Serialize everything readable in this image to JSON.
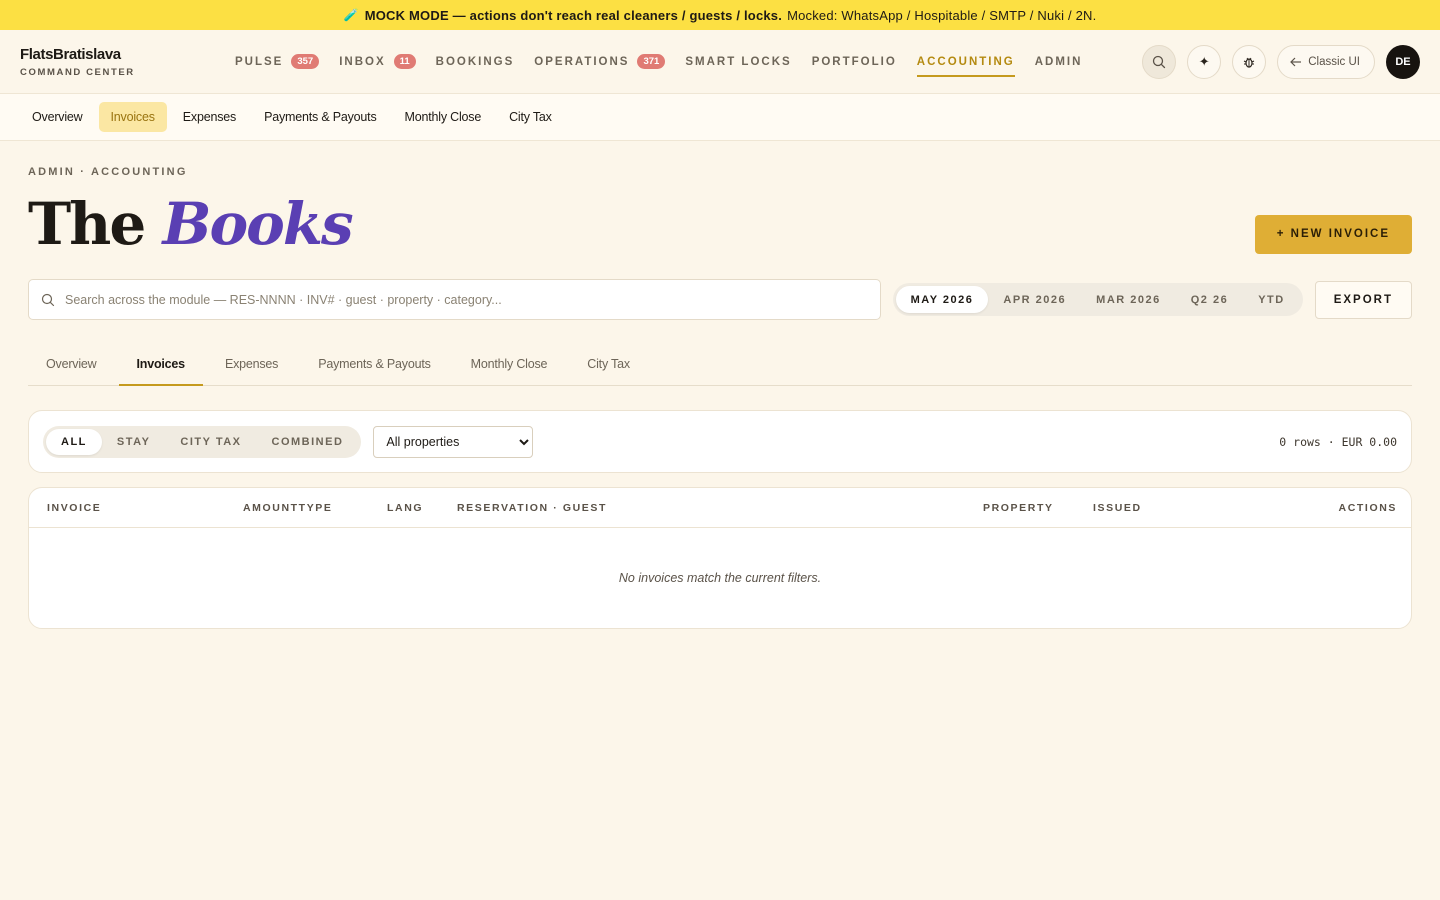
{
  "banner": {
    "emoji": "🧪",
    "strong": "MOCK MODE — actions don't reach real cleaners / guests / locks.",
    "rest": "Mocked: WhatsApp / Hospitable / SMTP / Nuki / 2N."
  },
  "brand": {
    "name": "FlatsBratislava",
    "subtitle": "COMMAND CENTER"
  },
  "nav": {
    "items": [
      {
        "label": "PULSE",
        "badge": "357"
      },
      {
        "label": "INBOX",
        "badge": "11"
      },
      {
        "label": "BOOKINGS",
        "badge": ""
      },
      {
        "label": "OPERATIONS",
        "badge": "371"
      },
      {
        "label": "SMART LOCKS",
        "badge": ""
      },
      {
        "label": "PORTFOLIO",
        "badge": ""
      },
      {
        "label": "ACCOUNTING",
        "badge": ""
      },
      {
        "label": "ADMIN",
        "badge": ""
      }
    ],
    "active": "ACCOUNTING",
    "classic_label": "Classic UI",
    "avatar": "DE"
  },
  "subnav": {
    "items": [
      "Overview",
      "Invoices",
      "Expenses",
      "Payments & Payouts",
      "Monthly Close",
      "City Tax"
    ],
    "active": "Invoices"
  },
  "header": {
    "eyebrow": "ADMIN · ACCOUNTING",
    "title_plain": "The",
    "title_italic": "Books",
    "new_invoice_label": "+ NEW INVOICE"
  },
  "search": {
    "placeholder": "Search across the module — RES-NNNN · INV# · guest · property · category..."
  },
  "periods": {
    "items": [
      "MAY 2026",
      "APR 2026",
      "MAR 2026",
      "Q2 26",
      "YTD"
    ],
    "active": "MAY 2026"
  },
  "export_label": "EXPORT",
  "tabs": {
    "items": [
      "Overview",
      "Invoices",
      "Expenses",
      "Payments & Payouts",
      "Monthly Close",
      "City Tax"
    ],
    "active": "Invoices"
  },
  "filters": {
    "types": [
      "ALL",
      "STAY",
      "CITY TAX",
      "COMBINED"
    ],
    "active_type": "ALL",
    "property_selected": "All properties",
    "summary": "0 rows · EUR 0.00"
  },
  "table": {
    "columns": [
      "INVOICE",
      "AMOUNTTYPE",
      "LANG",
      "RESERVATION · GUEST",
      "PROPERTY",
      "ISSUED",
      "ACTIONS"
    ],
    "empty_message": "No invoices match the current filters."
  },
  "colors": {
    "banner": "#fce043",
    "accent": "#c59a1e",
    "primary_button": "#dfae35",
    "title_italic": "#5a3fb3",
    "badge": "#e07b74"
  }
}
